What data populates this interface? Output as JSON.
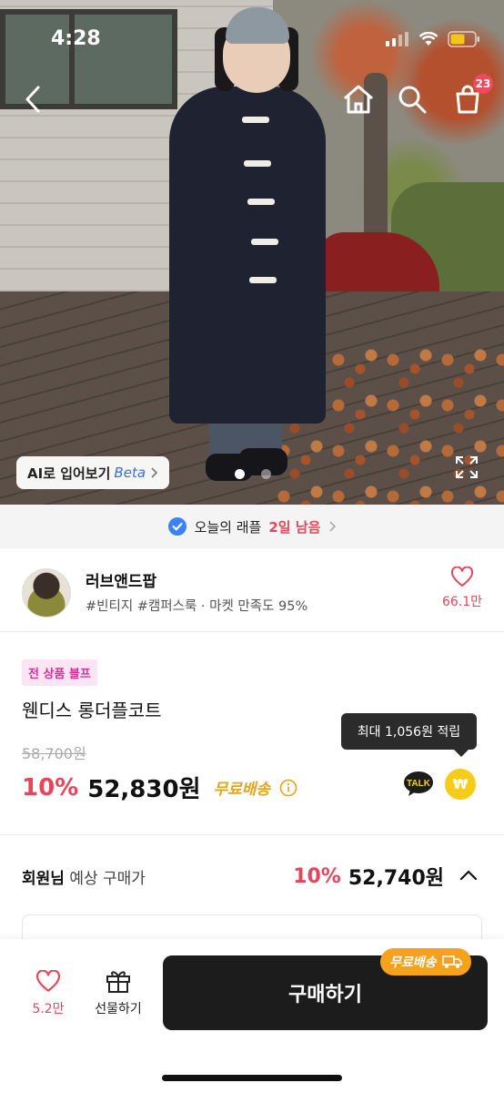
{
  "status_bar": {
    "time": "4:28"
  },
  "header": {
    "cart_count": "23"
  },
  "hero": {
    "ai_try_on_label": "AI로 입어보기",
    "ai_try_on_beta": "Beta",
    "current_image": 1,
    "total_images": 2
  },
  "raffle": {
    "prefix": "오늘의 래플",
    "highlight": "2일 남음"
  },
  "shop": {
    "name": "러브앤드팝",
    "tags": "#빈티지 #캠퍼스룩 · 마켓 만족도 95%",
    "likes": "66.1만"
  },
  "product": {
    "badge": "전 상품 블프",
    "name": "웬디스 롱더플코트",
    "original_price": "58,700원",
    "discount": "10%",
    "price": "52,830원",
    "shipping": "무료배송",
    "points_tooltip": "최대 1,056원 적립",
    "talk_label": "TALK",
    "points_icon_label": "₩"
  },
  "member": {
    "label_bold": "회원님",
    "label_rest": " 예상 구매가",
    "discount": "10%",
    "price": "52,740원"
  },
  "bottom_bar": {
    "likes": "5.2만",
    "gift_label": "선물하기",
    "buy_label": "구매하기",
    "buy_shipping": "무료배송"
  },
  "colors": {
    "accent_red": "#e8455a",
    "shipping_orange": "#e8a31b",
    "badge_pink": "#d6339a"
  }
}
